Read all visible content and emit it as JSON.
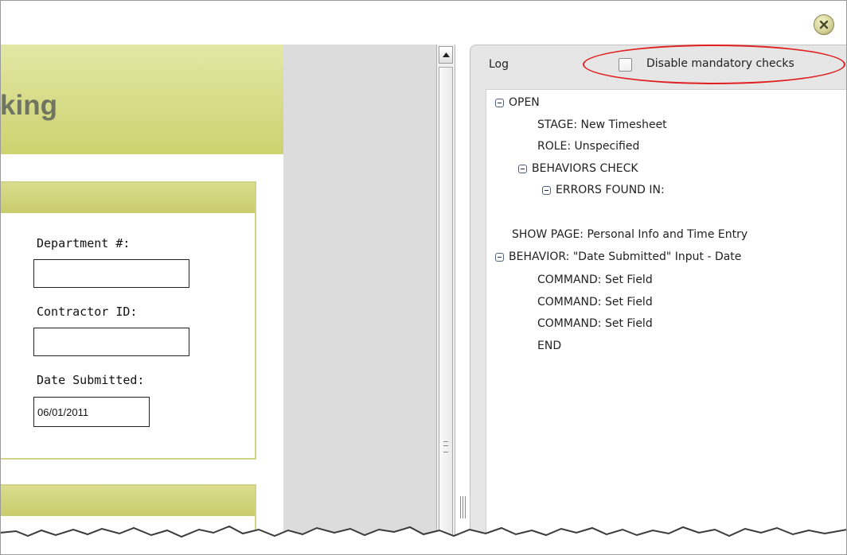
{
  "window": {
    "close_icon": "close-icon"
  },
  "form": {
    "title_fragment": "king",
    "fields": [
      {
        "label": "Department #:",
        "value": ""
      },
      {
        "label": "Contractor ID:",
        "value": ""
      },
      {
        "label": "Date Submitted:",
        "value": "06/01/2011"
      }
    ]
  },
  "log": {
    "title": "Log",
    "checkbox_label": "Disable mandatory checks",
    "checkbox_checked": false,
    "lines": [
      "OPEN",
      "STAGE: New Timesheet",
      "ROLE: Unspecified",
      "BEHAVIORS CHECK",
      "ERRORS FOUND IN:",
      "SHOW PAGE: Personal Info and Time Entry",
      "BEHAVIOR: \"Date Submitted\" Input - Date",
      "COMMAND: Set Field",
      "COMMAND: Set Field",
      "COMMAND: Set Field",
      "END"
    ]
  },
  "colors": {
    "accent_green": "#cdd26f",
    "highlight_red": "#e02020"
  }
}
